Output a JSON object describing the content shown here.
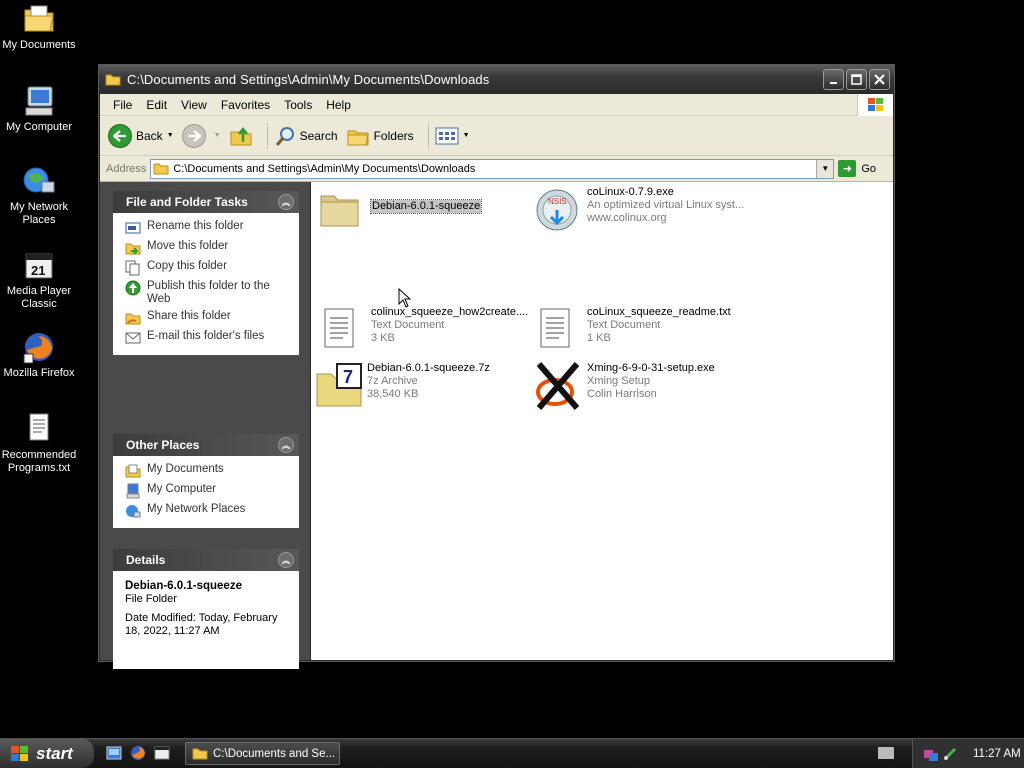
{
  "desktop": {
    "icons": [
      {
        "label": "My Documents",
        "icon": "my-documents-icon"
      },
      {
        "label": "My Computer",
        "icon": "my-computer-icon"
      },
      {
        "label": "My Network Places",
        "icon": "network-places-icon"
      },
      {
        "label": "Media Player Classic",
        "icon": "media-player-icon"
      },
      {
        "label": "Mozilla Firefox",
        "icon": "firefox-icon"
      },
      {
        "label": "Recommended Programs.txt",
        "icon": "text-file-icon"
      }
    ]
  },
  "window": {
    "title": "C:\\Documents and Settings\\Admin\\My Documents\\Downloads",
    "menu": [
      "File",
      "Edit",
      "View",
      "Favorites",
      "Tools",
      "Help"
    ],
    "toolbar": {
      "back": "Back",
      "search": "Search",
      "folders": "Folders"
    },
    "address": {
      "label": "Address",
      "value": "C:\\Documents and Settings\\Admin\\My Documents\\Downloads",
      "go": "Go"
    },
    "sidebar": {
      "tasks": {
        "title": "File and Folder Tasks",
        "items": [
          "Rename this folder",
          "Move this folder",
          "Copy this folder",
          "Publish this folder to the Web",
          "Share this folder",
          "E-mail this folder's files"
        ]
      },
      "places": {
        "title": "Other Places",
        "items": [
          "My Documents",
          "My Computer",
          "My Network Places"
        ]
      },
      "details": {
        "title": "Details",
        "name": "Debian-6.0.1-squeeze",
        "type": "File Folder",
        "modified": "Date Modified: Today, February 18, 2022, 11:27 AM"
      }
    },
    "files": [
      {
        "name": "Debian-6.0.1-squeeze",
        "line2": "",
        "line3": "",
        "icon": "folder-icon"
      },
      {
        "name": "coLinux-0.7.9.exe",
        "line2": "An optimized virtual Linux syst...",
        "line3": "www.colinux.org",
        "icon": "installer-icon"
      },
      {
        "name": "colinux_squeeze_how2create....",
        "line2": "Text Document",
        "line3": "3 KB",
        "icon": "text-document-icon"
      },
      {
        "name": "coLinux_squeeze_readme.txt",
        "line2": "Text Document",
        "line3": "1 KB",
        "icon": "text-document-icon"
      },
      {
        "name": "Debian-6.0.1-squeeze.7z",
        "line2": "7z Archive",
        "line3": "38,540 KB",
        "icon": "archive-7z-icon"
      },
      {
        "name": "Xming-6-9-0-31-setup.exe",
        "line2": "Xming Setup",
        "line3": "Colin Harrison",
        "icon": "xming-icon"
      }
    ]
  },
  "taskbar": {
    "start": "start",
    "task_item": "C:\\Documents and Se...",
    "clock": "11:27 AM"
  },
  "colors": {
    "selection": "#c4c4c4",
    "panel_head": "#4a4a4a",
    "go_green": "#2d9a2d"
  }
}
